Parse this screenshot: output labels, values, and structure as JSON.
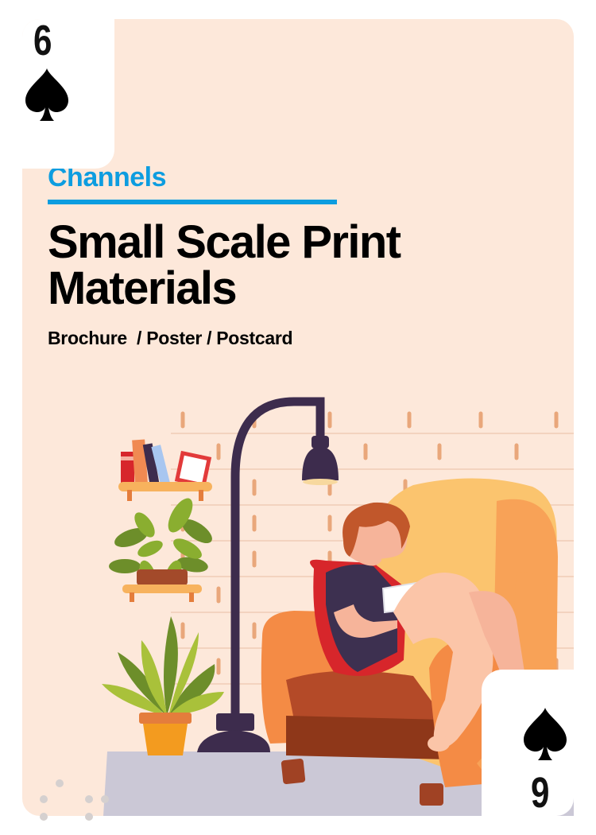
{
  "card": {
    "rank_top": "6",
    "rank_bottom": "9",
    "suit": "spade-icon",
    "background_color": "#fde8da",
    "accent_color": "#0d9de0"
  },
  "content": {
    "category": "Channels",
    "title": "Small Scale Print Materials",
    "subtitle": "Brochure  / Poster / Postcard"
  },
  "illustration": {
    "icons": [
      "floor-lamp-icon",
      "armchair-icon",
      "woman-reading-icon",
      "bookshelf-icon",
      "potted-plant-icon",
      "tablet-icon"
    ]
  }
}
